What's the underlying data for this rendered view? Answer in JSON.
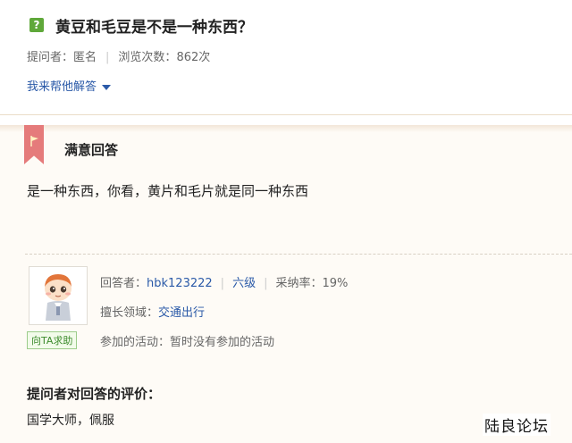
{
  "question": {
    "icon": "question-icon",
    "icon_glyph": "?",
    "title": "黄豆和毛豆是不是一种东西？",
    "asker_label": "提问者：",
    "asker": "匿名",
    "views_label": "浏览次数：",
    "views": "862次",
    "help_link": "我来帮他解答"
  },
  "answer": {
    "badge_label": "满意回答",
    "text": "是一种东西，你看，黄片和毛片就是同一种东西",
    "answerer_label": "回答者：",
    "answerer": "hbk123222",
    "level": "六级",
    "adopt_rate_label": "采纳率：",
    "adopt_rate": "19%",
    "expertise_label": "擅长领域：",
    "expertise": "交通出行",
    "activity_label": "参加的活动：",
    "activity": "暂时没有参加的活动",
    "ask_help_button": "向TA求助"
  },
  "evaluation": {
    "title": "提问者对回答的评价：",
    "text": "国学大师，佩服"
  },
  "watermark": "陆良论坛",
  "colors": {
    "link": "#2b5aa8",
    "ribbon": "#e57b7b",
    "question_icon": "#5fa83a",
    "answer_bg": "#fefbf6"
  }
}
